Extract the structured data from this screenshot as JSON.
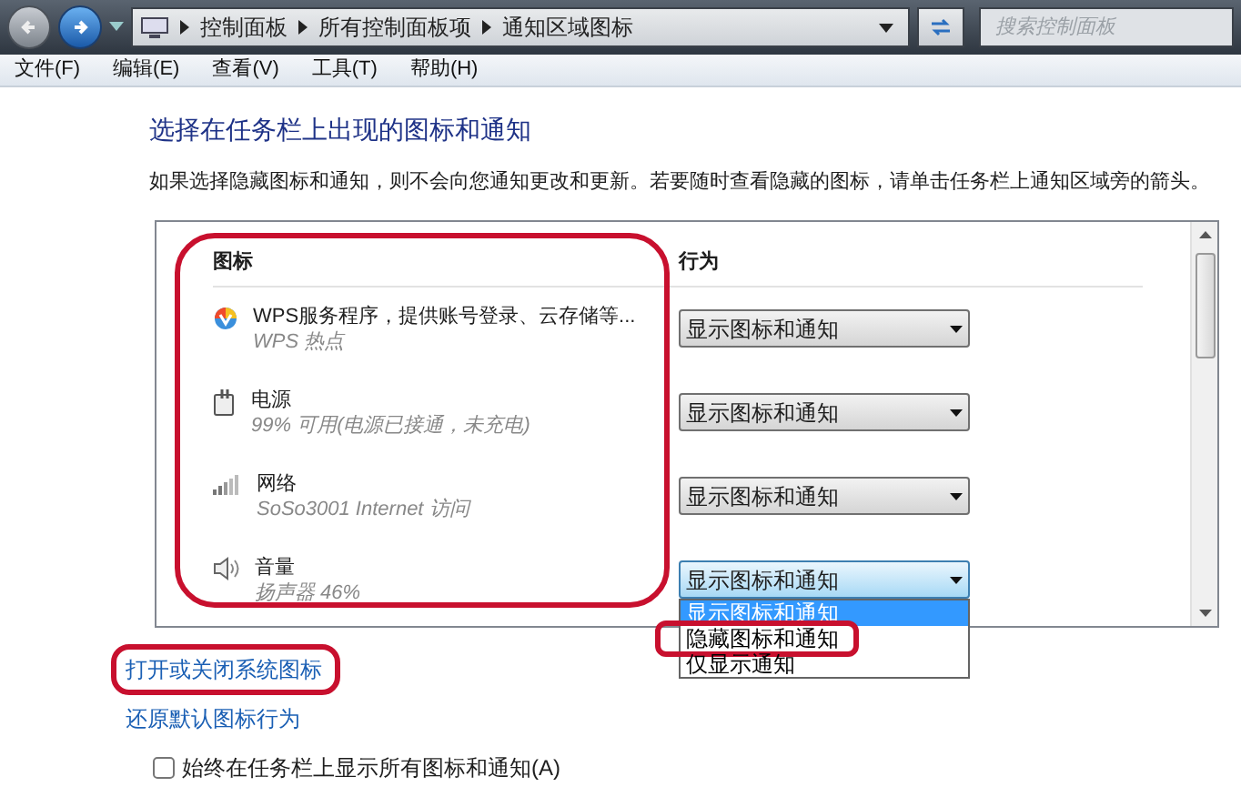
{
  "address_bar": {
    "breadcrumb": [
      "控制面板",
      "所有控制面板项",
      "通知区域图标"
    ],
    "search_placeholder": "搜索控制面板"
  },
  "menu": [
    "文件(F)",
    "编辑(E)",
    "查看(V)",
    "工具(T)",
    "帮助(H)"
  ],
  "heading": "选择在任务栏上出现的图标和通知",
  "description": "如果选择隐藏图标和通知，则不会向您通知更改和更新。若要随时查看隐藏的图标，请单击任务栏上通知区域旁的箭头。",
  "table": {
    "columns": [
      "图标",
      "行为"
    ],
    "icon_column_annotated": true,
    "rows": [
      {
        "kind": "app",
        "name": "WPS服务程序，提供账号登录、云存储等...",
        "detail": "WPS 热点",
        "behavior": "显示图标和通知",
        "expanded": false
      },
      {
        "kind": "power",
        "name": "电源",
        "detail": "99% 可用(电源已接通，未充电)",
        "behavior": "显示图标和通知",
        "expanded": false
      },
      {
        "kind": "network",
        "name": "网络",
        "detail": "SoSo3001 Internet 访问",
        "behavior": "显示图标和通知",
        "expanded": false
      },
      {
        "kind": "volume",
        "name": "音量",
        "detail": "扬声器 46%",
        "behavior": "显示图标和通知",
        "expanded": true
      }
    ],
    "options": [
      {
        "label": "显示图标和通知",
        "selected": true,
        "annotated": false
      },
      {
        "label": "隐藏图标和通知",
        "selected": false,
        "annotated": true
      },
      {
        "label": "仅显示通知",
        "selected": false,
        "annotated": false
      }
    ]
  },
  "links": [
    {
      "label": "打开或关闭系统图标",
      "annotated": true
    },
    {
      "label": "还原默认图标行为",
      "annotated": false
    }
  ],
  "checkbox": {
    "label": "始终在任务栏上显示所有图标和通知(A)",
    "checked": false
  }
}
